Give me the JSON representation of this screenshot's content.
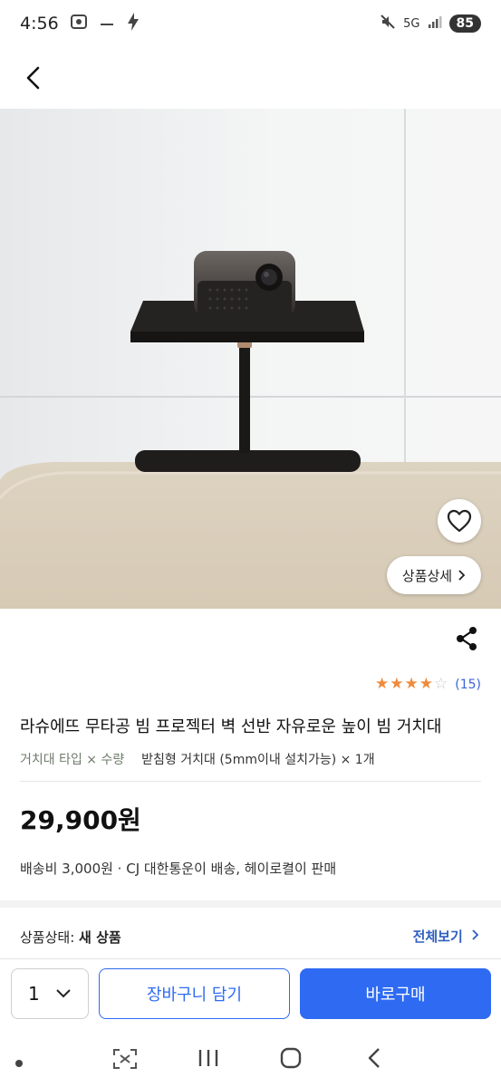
{
  "status_bar": {
    "time": "4:56",
    "network": "5G",
    "battery": "85"
  },
  "product": {
    "image_dots": 5,
    "active_dot": 4,
    "detail_button": "상품상세",
    "rating": 4,
    "rating_max": 5,
    "review_count": "(15)",
    "title": "라슈에뜨 무타공 빔 프로젝터 벽 선반 자유로운 높이 빔 거치대",
    "option_label": "거치대 타입 × 수량",
    "option_value": "받침형 거치대 (5mm이내 설치가능) × 1개",
    "price": "29,900원",
    "shipping": "배송비 3,000원 · CJ 대한통운이 배송, 헤이로켤이 판매",
    "condition_label": "상품상태:",
    "condition_value": "새 상품",
    "view_all": "전체보기"
  },
  "actions": {
    "quantity": "1",
    "cart_label": "장바구니 담기",
    "buy_label": "바로구매"
  },
  "colors": {
    "accent": "#2e6bf2",
    "star": "#f08a3c",
    "link": "#2f5fc0"
  }
}
